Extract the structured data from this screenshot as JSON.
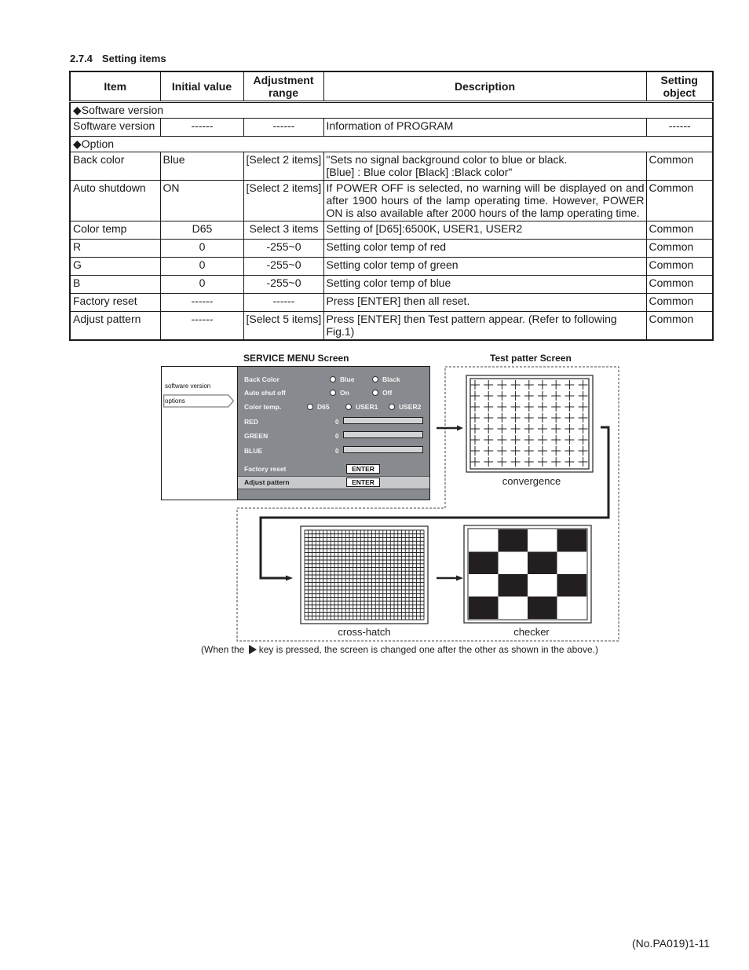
{
  "section": {
    "number": "2.7.4",
    "title": "Setting items"
  },
  "table": {
    "headers": {
      "item": "Item",
      "initial": "Initial value",
      "range_line1": "Adjustment",
      "range_line2": "range",
      "description": "Description",
      "object_line1": "Setting",
      "object_line2": "object"
    },
    "groups": {
      "software": "◆Software version",
      "option": "◆Option"
    },
    "rows": [
      {
        "item": "Software version",
        "initial": "------",
        "range": "------",
        "description": "Information of PROGRAM",
        "object": "------"
      },
      {
        "item": "Back color",
        "initial": "Blue",
        "range": "[Select 2 items]",
        "description_line1": "\"Sets no signal background color to blue or black.",
        "description_line2": "[Blue] : Blue color [Black] :Black color\"",
        "object": "Common"
      },
      {
        "item": "Auto shutdown",
        "initial": "ON",
        "range": "[Select 2 items]",
        "description": "If POWER OFF is selected, no warning will be displayed on and after 1900 hours of the lamp operating time. However, POWER ON is also available after 2000 hours of the lamp operating time.",
        "object": "Common"
      },
      {
        "item": "Color temp",
        "initial": "D65",
        "range": "Select 3 items",
        "description": "Setting of [D65]:6500K, USER1, USER2",
        "object": "Common"
      },
      {
        "item": "R",
        "initial": "0",
        "range": "-255~0",
        "description": "Setting color temp of red",
        "object": "Common"
      },
      {
        "item": "G",
        "initial": "0",
        "range": "-255~0",
        "description": "Setting color temp of green",
        "object": "Common"
      },
      {
        "item": "B",
        "initial": "0",
        "range": "-255~0",
        "description": "Setting color temp of blue",
        "object": "Common"
      },
      {
        "item": "Factory reset",
        "initial": "------",
        "range": "------",
        "description": "Press [ENTER] then all reset.",
        "object": "Common"
      },
      {
        "item": "Adjust pattern",
        "initial": "------",
        "range": "[Select 5 items]",
        "description": "Press [ENTER] then Test pattern appear. (Refer to following Fig.1)",
        "object": "Common"
      }
    ]
  },
  "figure": {
    "service_menu_caption": "SERVICE MENU Screen",
    "test_pattern_caption": "Test patter Screen",
    "service_menu": {
      "sidebar": [
        "software version",
        "options"
      ],
      "back_color": {
        "label": "Back Color",
        "options": [
          "Blue",
          "Black"
        ]
      },
      "auto_shut_off": {
        "label": "Auto shut off",
        "options": [
          "On",
          "Off"
        ]
      },
      "color_temp": {
        "label": "Color temp.",
        "options": [
          "D65",
          "USER1",
          "USER2"
        ]
      },
      "red": {
        "label": "RED",
        "value": "0"
      },
      "green": {
        "label": "GREEN",
        "value": "0"
      },
      "blue": {
        "label": "BLUE",
        "value": "0"
      },
      "factory_reset": {
        "label": "Factory reset",
        "button": "ENTER"
      },
      "adjust_pattern": {
        "label": "Adjust pattern",
        "button": "ENTER"
      }
    },
    "patterns": {
      "convergence": "convergence",
      "cross_hatch": "cross-hatch",
      "checker": "checker"
    },
    "note_prefix": "(When the ",
    "note_suffix": "key is pressed, the screen is changed one after the other as shown in the above.)"
  },
  "page_number": "(No.PA019)1-11"
}
